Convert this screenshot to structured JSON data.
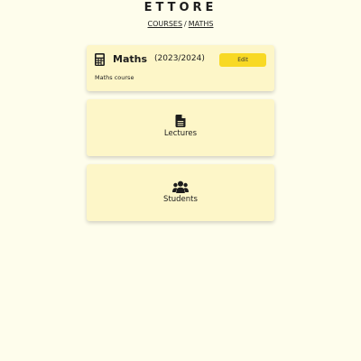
{
  "app": {
    "title": "ETTORE"
  },
  "breadcrumb": {
    "items": [
      "COURSES",
      "MATHS"
    ],
    "separator": "/"
  },
  "course": {
    "name": "Maths",
    "year": "(2023/2024)",
    "description": "Maths course",
    "edit_label": "Edit",
    "icon": "calculator-icon"
  },
  "sections": [
    {
      "label": "Lectures",
      "icon": "file-icon"
    },
    {
      "label": "Students",
      "icon": "users-icon"
    }
  ],
  "colors": {
    "background": "#fefdec",
    "card": "#fdf6c8",
    "accent": "#f8d924",
    "text": "#1d1d1d"
  }
}
